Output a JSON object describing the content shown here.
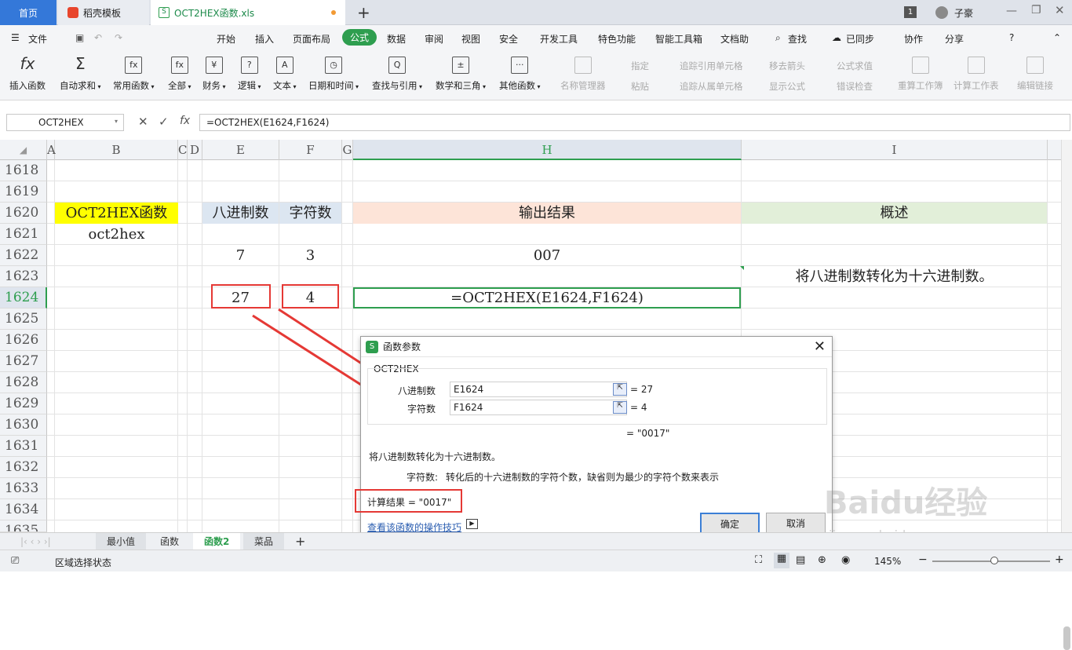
{
  "tabs": {
    "home": "首页",
    "docer": "稻壳模板",
    "file": "OCT2HEX函数.xls",
    "badge": "1",
    "user": "子豪"
  },
  "menu": {
    "file": "文件",
    "items": [
      "开始",
      "插入",
      "页面布局",
      "公式",
      "数据",
      "审阅",
      "视图",
      "安全",
      "开发工具",
      "特色功能",
      "智能工具箱",
      "文档助"
    ],
    "active_index": 3,
    "search": "查找",
    "sync": "已同步",
    "collab": "协作",
    "share": "分享"
  },
  "ribbon": {
    "buttons": [
      {
        "label": "插入函数",
        "icon": "fx"
      },
      {
        "label": "自动求和",
        "icon": "Σ"
      },
      {
        "label": "常用函数",
        "icon": "fx"
      },
      {
        "label": "全部",
        "icon": "fx"
      },
      {
        "label": "财务",
        "icon": "¥"
      },
      {
        "label": "逻辑",
        "icon": "?"
      },
      {
        "label": "文本",
        "icon": "A"
      },
      {
        "label": "日期和时间",
        "icon": "◷"
      },
      {
        "label": "查找与引用",
        "icon": "Q"
      },
      {
        "label": "数学和三角",
        "icon": "±"
      },
      {
        "label": "其他函数",
        "icon": "···"
      }
    ],
    "disabled": {
      "name_manager": "名称管理器",
      "specify": "指定",
      "paste": "粘贴",
      "trace_prec": "追踪引用单元格",
      "trace_dep": "追踪从属单元格",
      "remove_arrows": "移去箭头",
      "show_formula": "显示公式",
      "eval_formula": "公式求值",
      "error_check": "错误检查",
      "recalc_book": "重算工作簿",
      "calc_sheet": "计算工作表",
      "edit_links": "编辑链接"
    }
  },
  "formula_bar": {
    "name_box": "OCT2HEX",
    "formula": "=OCT2HEX(E1624,F1624)",
    "fx": "fx"
  },
  "columns": [
    "A",
    "B",
    "C",
    "D",
    "E",
    "F",
    "G",
    "H",
    "I"
  ],
  "rows": [
    "1618",
    "1619",
    "1620",
    "1621",
    "1622",
    "1623",
    "1624",
    "1625",
    "1626",
    "1627",
    "1628",
    "1629",
    "1630",
    "1631",
    "1632",
    "1633",
    "1634",
    "1635"
  ],
  "cells": {
    "b1620": "OCT2HEX函数",
    "b1621": "oct2hex",
    "e1620": "八进制数",
    "f1620": "字符数",
    "h1620": "输出结果",
    "i1620": "概述",
    "e1622": "7",
    "f1622": "3",
    "h1622": "007",
    "i1623": "将八进制数转化为十六进制数。",
    "e1624": "27",
    "f1624": "4",
    "h1624": "=OCT2HEX(E1624,F1624)"
  },
  "colors": {
    "yellow": "#ffff00",
    "blue_header": "#dce6f1",
    "peach": "#fde4d8",
    "green_header": "#e2efd9",
    "accent": "#2e9e4f",
    "red_box": "#e53935"
  },
  "dialog": {
    "title": "函数参数",
    "func": "OCT2HEX",
    "arg1_label": "八进制数",
    "arg1_value": "E1624",
    "arg1_result": "= 27",
    "arg2_label": "字符数",
    "arg2_value": "F1624",
    "arg2_result": "= 4",
    "result_preview": "= \"0017\"",
    "description": "将八进制数转化为十六进制数。",
    "arg_help_label": "字符数:",
    "arg_help": "转化后的十六进制数的字符个数，缺省则为最少的字符个数来表示",
    "calc_result": "计算结果 = \"0017\"",
    "help_link": "查看该函数的操作技巧",
    "ok": "确定",
    "cancel": "取消"
  },
  "sheets": [
    "最小值",
    "函数",
    "函数2",
    "菜品"
  ],
  "active_sheet": 2,
  "status": {
    "text": "区域选择状态",
    "zoom": "145%"
  },
  "watermark": {
    "text": "Baidu经验",
    "url": "jingyan.baidu.com"
  }
}
